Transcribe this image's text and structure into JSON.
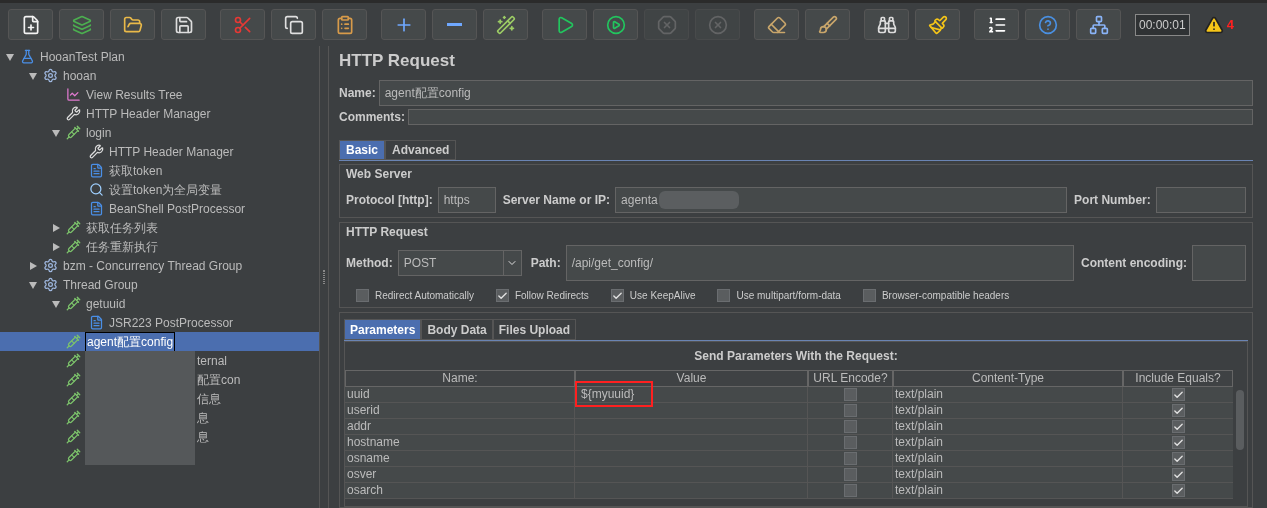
{
  "toolbar": {
    "groups": [
      [
        {
          "kind": "new",
          "disabled": false
        },
        {
          "kind": "templates",
          "disabled": false
        },
        {
          "kind": "open",
          "disabled": false
        },
        {
          "kind": "save",
          "disabled": false
        }
      ],
      [
        {
          "kind": "cut",
          "disabled": false
        },
        {
          "kind": "copy",
          "disabled": false
        },
        {
          "kind": "paste",
          "disabled": false
        }
      ],
      [
        {
          "kind": "expand",
          "disabled": false
        },
        {
          "kind": "collapse",
          "disabled": false
        },
        {
          "kind": "toggle",
          "disabled": false
        }
      ],
      [
        {
          "kind": "start",
          "disabled": false
        },
        {
          "kind": "start-no-timers",
          "disabled": false
        },
        {
          "kind": "stop",
          "disabled": true
        },
        {
          "kind": "shutdown",
          "disabled": true
        }
      ],
      [
        {
          "kind": "clear",
          "disabled": false
        },
        {
          "kind": "clear-all",
          "disabled": false
        }
      ],
      [
        {
          "kind": "search",
          "disabled": false
        },
        {
          "kind": "reset-search",
          "disabled": false
        }
      ],
      [
        {
          "kind": "functions",
          "disabled": false
        },
        {
          "kind": "help",
          "disabled": false
        },
        {
          "kind": "remote",
          "disabled": false
        }
      ]
    ],
    "timer": "00:00:01",
    "warning_count": "4"
  },
  "tree": [
    {
      "label": "HooanTest Plan",
      "kind": "plan",
      "expanded": true,
      "selected": false,
      "children": [
        {
          "label": "hooan",
          "kind": "threadgroup",
          "expanded": true,
          "selected": false,
          "children": [
            {
              "label": "View Results Tree",
              "kind": "listener",
              "selected": false
            },
            {
              "label": "HTTP Header Manager",
              "kind": "config",
              "selected": false
            },
            {
              "label": "login",
              "kind": "sampler",
              "expanded": true,
              "selected": false,
              "children": [
                {
                  "label": "HTTP Header Manager",
                  "kind": "config",
                  "selected": false
                },
                {
                  "label": "获取token",
                  "kind": "processor",
                  "selected": false
                },
                {
                  "label": "设置token为全局变量",
                  "kind": "extractor",
                  "selected": false
                },
                {
                  "label": "BeanShell PostProcessor",
                  "kind": "processor",
                  "selected": false
                }
              ]
            },
            {
              "label": "获取任务列表",
              "kind": "sampler",
              "expanded": false,
              "selected": false
            },
            {
              "label": "任务重新执行",
              "kind": "sampler",
              "expanded": false,
              "selected": false
            }
          ]
        },
        {
          "label": "bzm - Concurrency Thread Group",
          "kind": "threadgroup",
          "expanded": false,
          "selected": false
        },
        {
          "label": "Thread Group",
          "kind": "threadgroup",
          "expanded": true,
          "selected": false,
          "children": [
            {
              "label": "getuuid",
              "kind": "sampler",
              "expanded": true,
              "selected": false,
              "children": [
                {
                  "label": "JSR223 PostProcessor",
                  "kind": "processor",
                  "selected": false
                }
              ]
            },
            {
              "label": "agent配置config",
              "kind": "sampler",
              "selected": true
            },
            {
              "label": "ternal",
              "kind": "redacted",
              "selected": false
            },
            {
              "label": "配置con",
              "kind": "redacted",
              "selected": false
            },
            {
              "label": "信息",
              "kind": "redacted",
              "selected": false
            },
            {
              "label": "息",
              "kind": "redacted",
              "selected": false
            },
            {
              "label": "息",
              "kind": "redacted",
              "selected": false
            },
            {
              "kind": "redacted",
              "selected": false
            }
          ]
        }
      ]
    }
  ],
  "panel": {
    "title": "HTTP Request",
    "name_label": "Name:",
    "name_value": "agent配置config",
    "comments_label": "Comments:",
    "tabs": [
      {
        "label": "Basic",
        "selected": true
      },
      {
        "label": "Advanced",
        "selected": false
      }
    ],
    "web_server": {
      "legend": "Web Server",
      "protocol_label": "Protocol [http]:",
      "protocol": "https",
      "server_label": "Server Name or IP:",
      "server": "agenta",
      "port_label": "Port Number:"
    },
    "http_request": {
      "legend": "HTTP Request",
      "method_label": "Method:",
      "method": "POST",
      "path_label": "Path:",
      "path": "/api/get_config/",
      "encoding_label": "Content encoding:",
      "options": [
        {
          "label": "Redirect Automatically",
          "checked": false
        },
        {
          "label": "Follow Redirects",
          "checked": true
        },
        {
          "label": "Use KeepAlive",
          "checked": true
        },
        {
          "label": "Use multipart/form-data",
          "checked": false
        },
        {
          "label": "Browser-compatible headers",
          "checked": false
        }
      ]
    },
    "param_tabs": [
      {
        "label": "Parameters",
        "selected": true
      },
      {
        "label": "Body Data",
        "selected": false
      },
      {
        "label": "Files Upload",
        "selected": false
      }
    ],
    "table": {
      "caption": "Send Parameters With the Request:",
      "columns": [
        "Name:",
        "Value",
        "URL Encode?",
        "Content-Type",
        "Include Equals?"
      ],
      "rows": [
        {
          "name": "uuid",
          "value": "${myuuid}",
          "highlighted": true,
          "url_encode": false,
          "content_type": "text/plain",
          "include_equals": true
        },
        {
          "name": "userid",
          "url_encode": false,
          "content_type": "text/plain",
          "include_equals": true
        },
        {
          "name": "addr",
          "url_encode": false,
          "content_type": "text/plain",
          "include_equals": true
        },
        {
          "name": "hostname",
          "url_encode": false,
          "content_type": "text/plain",
          "include_equals": true
        },
        {
          "name": "osname",
          "url_encode": false,
          "content_type": "text/plain",
          "include_equals": true
        },
        {
          "name": "osver",
          "url_encode": false,
          "content_type": "text/plain",
          "include_equals": true
        },
        {
          "name": "osarch",
          "url_encode": false,
          "content_type": "text/plain",
          "include_equals": true
        }
      ]
    }
  }
}
